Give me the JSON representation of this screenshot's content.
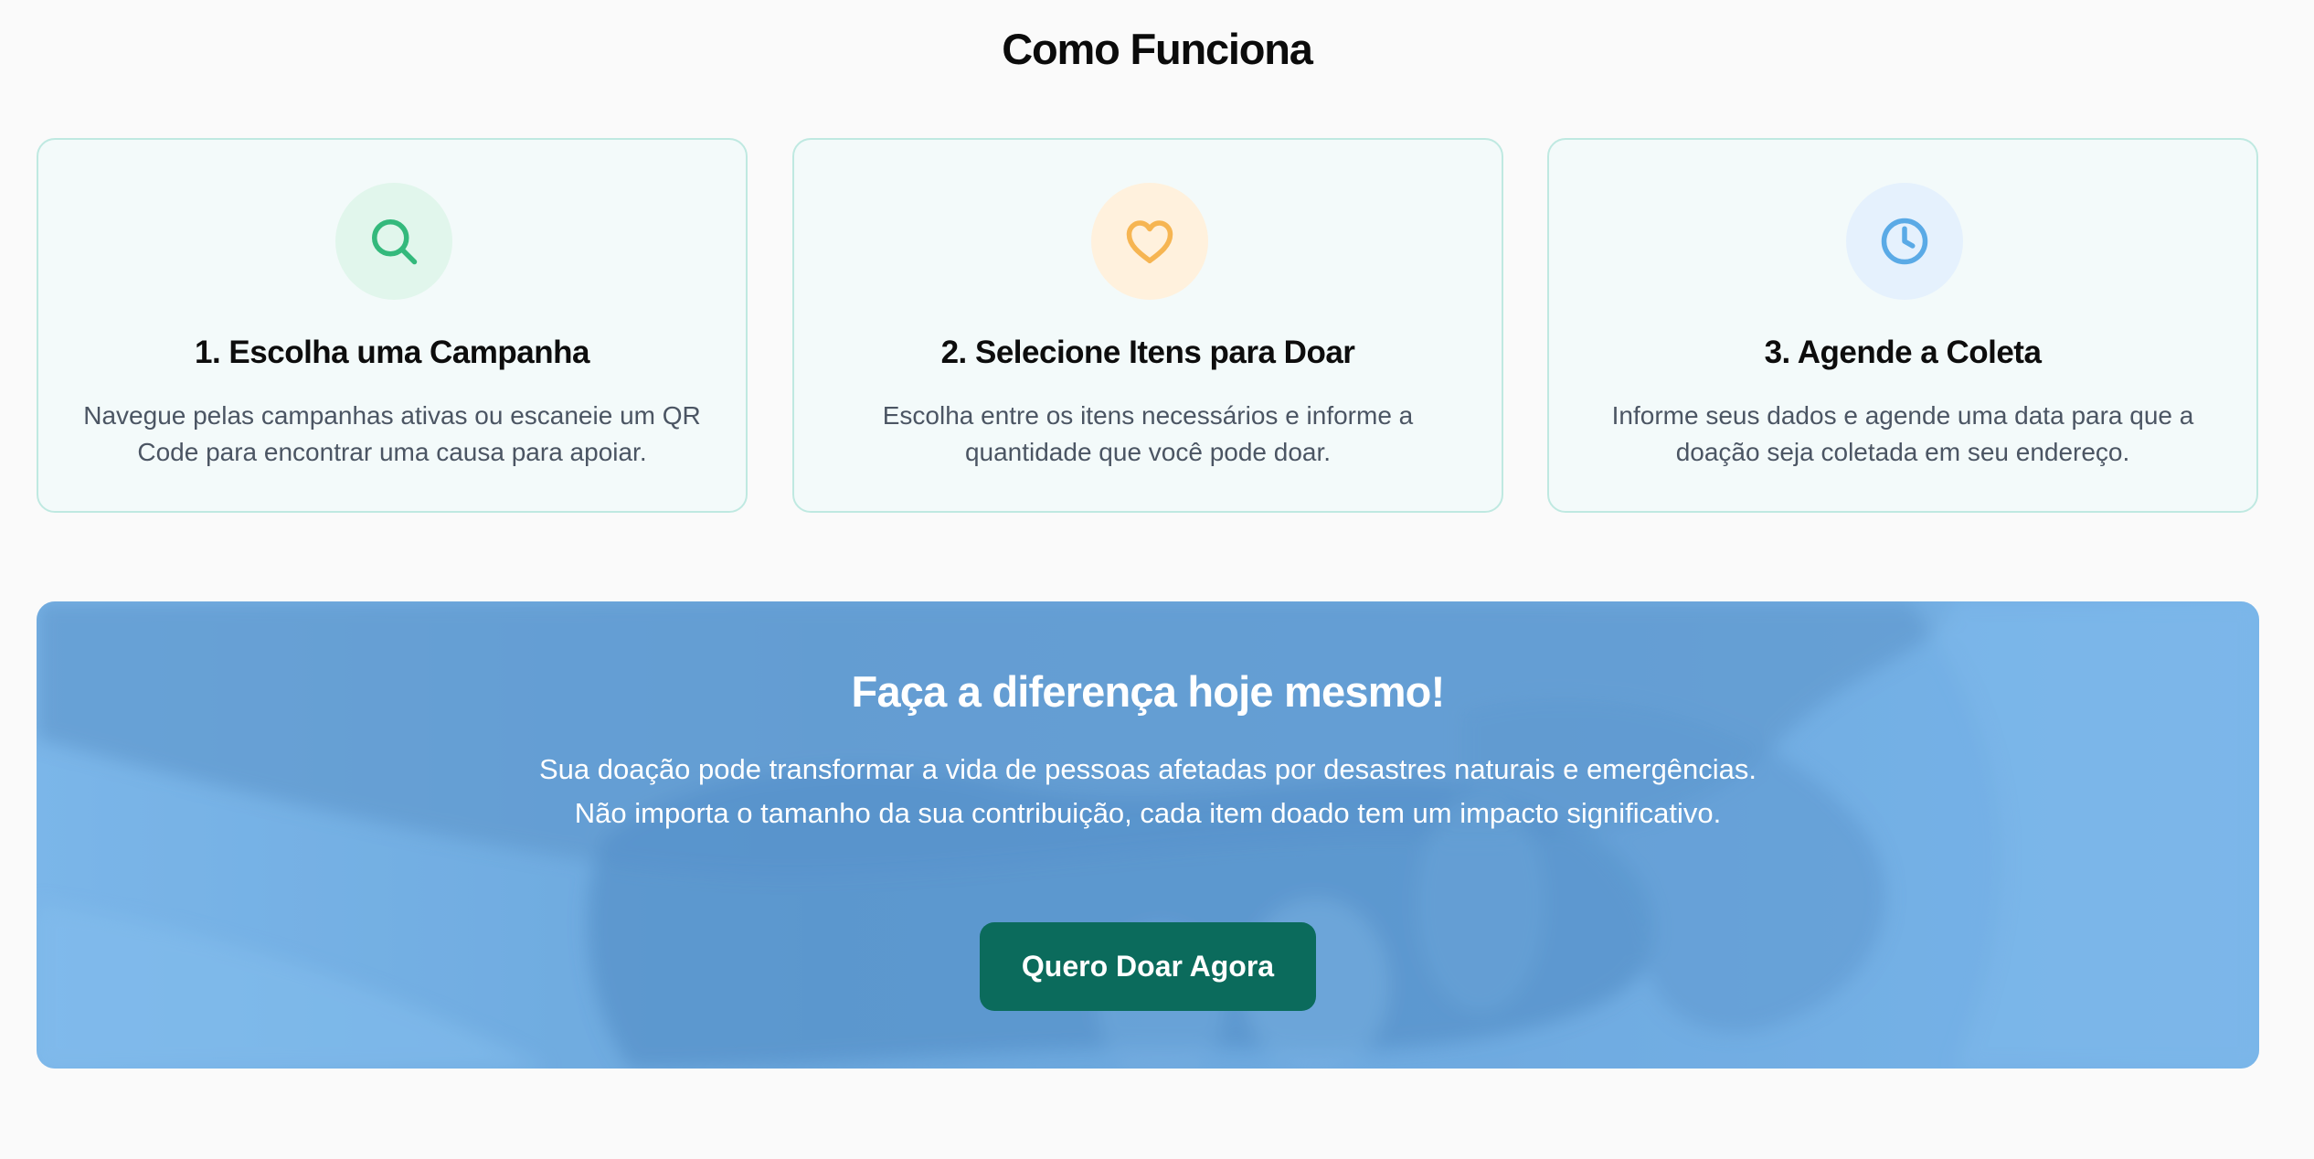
{
  "section": {
    "title": "Como Funciona"
  },
  "steps": [
    {
      "icon": "search-icon",
      "title": "1. Escolha uma Campanha",
      "description": "Navegue pelas campanhas ativas ou escaneie um QR Code para encontrar uma causa para apoiar.",
      "color": "#34b97c"
    },
    {
      "icon": "heart-icon",
      "title": "2. Selecione Itens para Doar",
      "description": "Escolha entre os itens necessários e informe a quantidade que você pode doar.",
      "color": "#f6b552"
    },
    {
      "icon": "clock-icon",
      "title": "3. Agende a Coleta",
      "description": "Informe seus dados e agende uma data para que a doação seja coletada em seu endereço.",
      "color": "#5aaae6"
    }
  ],
  "banner": {
    "title": "Faça a diferença hoje mesmo!",
    "text": "Sua doação pode transformar a vida de pessoas afetadas por desastres naturais e emergências. Não importa o tamanho da sua contribuição, cada item doado tem um impacto significativo.",
    "button_label": "Quero Doar Agora",
    "button_color": "#0b6b5c"
  }
}
